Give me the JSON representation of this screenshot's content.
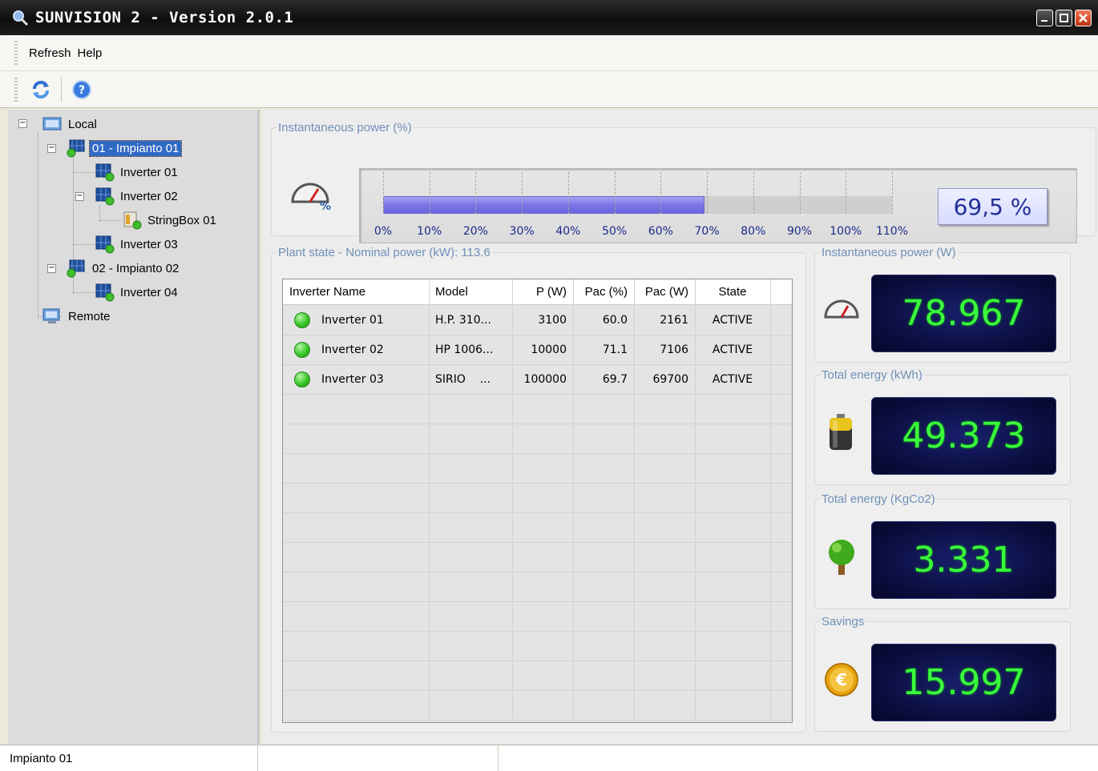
{
  "window": {
    "title": "SUNVISION 2 - Version 2.0.1"
  },
  "menu": {
    "items": [
      "Refresh",
      "Help"
    ]
  },
  "tree": {
    "nodes": [
      {
        "label": "Local"
      },
      {
        "label": "01 - Impianto 01"
      },
      {
        "label": "Inverter 01"
      },
      {
        "label": "Inverter 02"
      },
      {
        "label": "StringBox 01"
      },
      {
        "label": "Inverter 03"
      },
      {
        "label": "02 - Impianto 02"
      },
      {
        "label": "Inverter 04"
      },
      {
        "label": "Remote"
      }
    ]
  },
  "instant_power_pct": {
    "legend": "Instantaneous power (%)",
    "value": 69.5,
    "display": "69,5 %",
    "scale_max": 110,
    "ticks": [
      "0%",
      "10%",
      "20%",
      "30%",
      "40%",
      "50%",
      "60%",
      "70%",
      "80%",
      "90%",
      "100%",
      "110%"
    ]
  },
  "plant": {
    "legend": "Plant state - Nominal power (kW): 113.6",
    "columns": [
      "Inverter Name",
      "Model",
      "P (W)",
      "Pac (%)",
      "Pac (W)",
      "State"
    ],
    "rows": [
      {
        "name": "Inverter 01",
        "model": "H.P. 310...",
        "p": "3100",
        "pac_pct": "60.0",
        "pac_w": "2161",
        "state": "ACTIVE"
      },
      {
        "name": "Inverter 02",
        "model": "HP 1006...",
        "p": "10000",
        "pac_pct": "71.1",
        "pac_w": "7106",
        "state": "ACTIVE"
      },
      {
        "name": "Inverter 03",
        "model": "SIRIO    ...",
        "p": "100000",
        "pac_pct": "69.7",
        "pac_w": "69700",
        "state": "ACTIVE"
      }
    ]
  },
  "panels": {
    "instant_power_w": {
      "legend": "Instantaneous power (W)",
      "value": "78.967",
      "icon": "gauge-icon"
    },
    "total_energy_kwh": {
      "legend": "Total energy (kWh)",
      "value": "49.373",
      "icon": "battery-icon"
    },
    "total_energy_kgco2": {
      "legend": "Total energy (KgCo2)",
      "value": "3.331",
      "icon": "tree-icon"
    },
    "savings": {
      "legend": "Savings",
      "value": "15.997",
      "icon": "euro-coin-icon"
    }
  },
  "status": {
    "text": "Impianto 01"
  },
  "colors": {
    "accent": "#316ac5",
    "bar": "#7c76e6",
    "lcd_text": "#39ff3a",
    "lcd_bg": "#0a0d3c"
  }
}
